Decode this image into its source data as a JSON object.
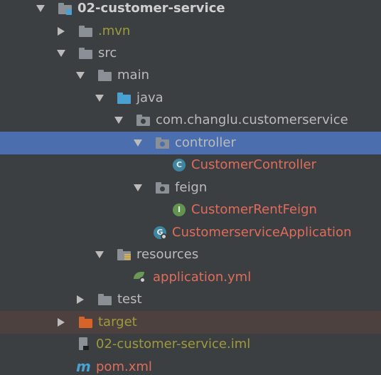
{
  "tree": {
    "items": [
      {
        "label": "02-customer-service"
      },
      {
        "label": ".mvn"
      },
      {
        "label": "src"
      },
      {
        "label": "main"
      },
      {
        "label": "java"
      },
      {
        "label": "com.changlu.customerservice"
      },
      {
        "label": "controller"
      },
      {
        "label": "CustomerController",
        "badge": "C"
      },
      {
        "label": "feign"
      },
      {
        "label": "CustomerRentFeign",
        "badge": "I"
      },
      {
        "label": "CustomerserviceApplication",
        "badge": "G"
      },
      {
        "label": "resources"
      },
      {
        "label": "application.yml"
      },
      {
        "label": "test"
      },
      {
        "label": "target"
      },
      {
        "label": "02-customer-service.iml"
      },
      {
        "label": "pom.xml",
        "icon_glyph": "m"
      }
    ]
  },
  "colors": {
    "background": "#3c3f41",
    "selection": "#4b6eaf",
    "excluded_row": "#4d4140",
    "text_default": "#bbbbbb",
    "text_modified": "#e06c5b",
    "text_untracked": "#9e9a3c"
  }
}
